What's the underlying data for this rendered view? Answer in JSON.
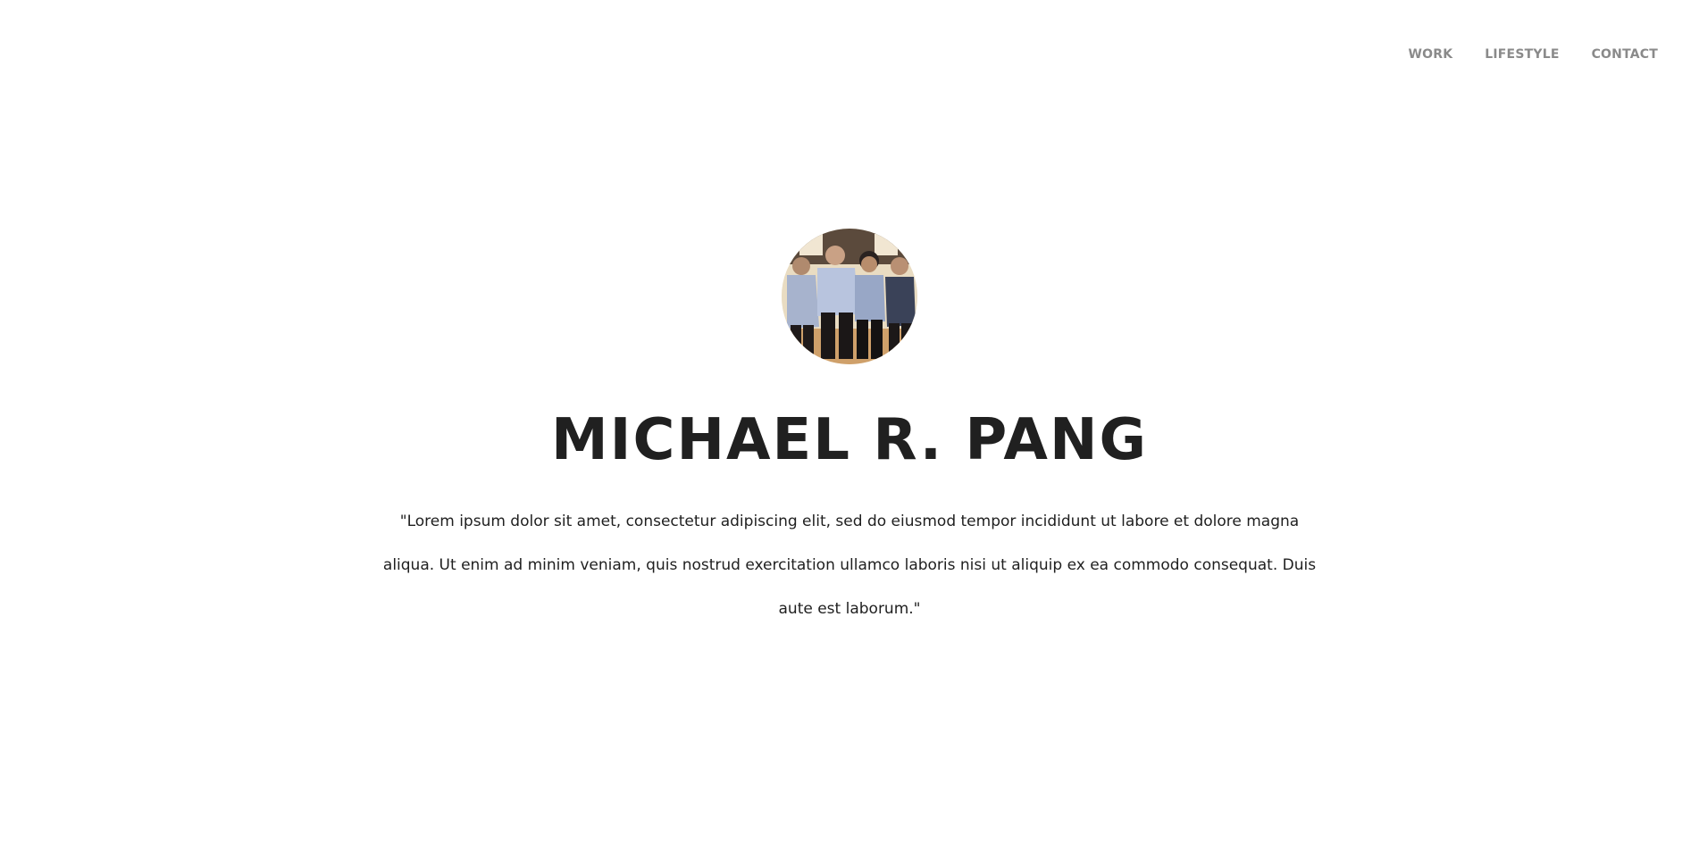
{
  "nav": {
    "items": [
      {
        "label": "WORK"
      },
      {
        "label": "LIFESTYLE"
      },
      {
        "label": "CONTACT"
      }
    ]
  },
  "hero": {
    "name": "MICHAEL R. PANG",
    "quote": "\"Lorem ipsum dolor sit amet, consectetur adipiscing elit, sed do eiusmod tempor incididunt ut labore et dolore magna aliqua. Ut enim ad minim veniam, quis nostrud exercitation ullamco laboris nisi ut aliquip ex ea commodo consequat. Duis aute  est laborum.\""
  },
  "colors": {
    "background": "#ffffff",
    "nav_text": "#8a8a8a",
    "heading": "#202020",
    "body_text": "#1f1f1f"
  }
}
